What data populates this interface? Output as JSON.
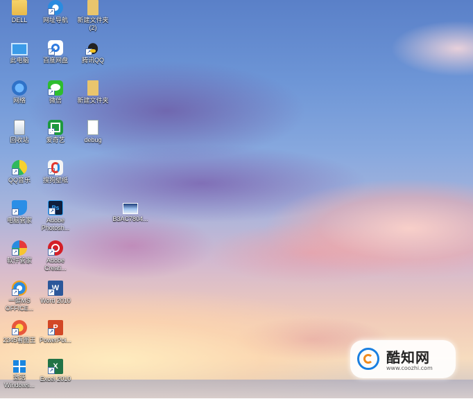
{
  "desktop": {
    "icons": [
      {
        "label": "DELL",
        "icon": "folder-icon"
      },
      {
        "label": "网址导航",
        "icon": "internet-explorer-icon"
      },
      {
        "label": "新建文件夹\n(2)",
        "icon": "file-icon"
      },
      {
        "label": "此电脑",
        "icon": "computer-icon"
      },
      {
        "label": "百度网盘",
        "icon": "baidu-netdisk-icon"
      },
      {
        "label": "腾讯QQ",
        "icon": "qq-icon"
      },
      {
        "label": "网络",
        "icon": "network-icon"
      },
      {
        "label": "微信",
        "icon": "wechat-icon"
      },
      {
        "label": "新建文件夹",
        "icon": "folder-icon"
      },
      {
        "label": "回收站",
        "icon": "recycle-bin-icon"
      },
      {
        "label": "爱奇艺",
        "icon": "iqiyi-icon"
      },
      {
        "label": "debug",
        "icon": "document-icon"
      },
      {
        "label": "QQ音乐",
        "icon": "qq-music-icon"
      },
      {
        "label": "搜狗壁纸",
        "icon": "sogou-wallpaper-icon"
      },
      {
        "label": "电脑管家",
        "icon": "pc-manager-shield-icon"
      },
      {
        "label": "Adobe\nPhotosh...",
        "icon": "photoshop-icon"
      },
      {
        "label": "B3AC7804...",
        "icon": "image-thumbnail-icon"
      },
      {
        "label": "软件管家",
        "icon": "software-manager-icon"
      },
      {
        "label": "Adobe\nCreati...",
        "icon": "adobe-creative-cloud-icon"
      },
      {
        "label": "一键MS\nOFFICE...",
        "icon": "office-installer-icon"
      },
      {
        "label": "Word 2010",
        "icon": "word-icon"
      },
      {
        "label": "2345看图王",
        "icon": "2345-viewer-icon"
      },
      {
        "label": "PowerPoi...",
        "icon": "powerpoint-icon"
      },
      {
        "label": "激活\nWindows...",
        "icon": "windows-icon"
      },
      {
        "label": "Excel 2010",
        "icon": "excel-icon"
      }
    ]
  },
  "watermark": {
    "title": "酷知网",
    "url": "www.coozhi.com"
  },
  "colors": {
    "sky_top": "#5a80c8",
    "sky_sunset": "#f1cbb9"
  }
}
